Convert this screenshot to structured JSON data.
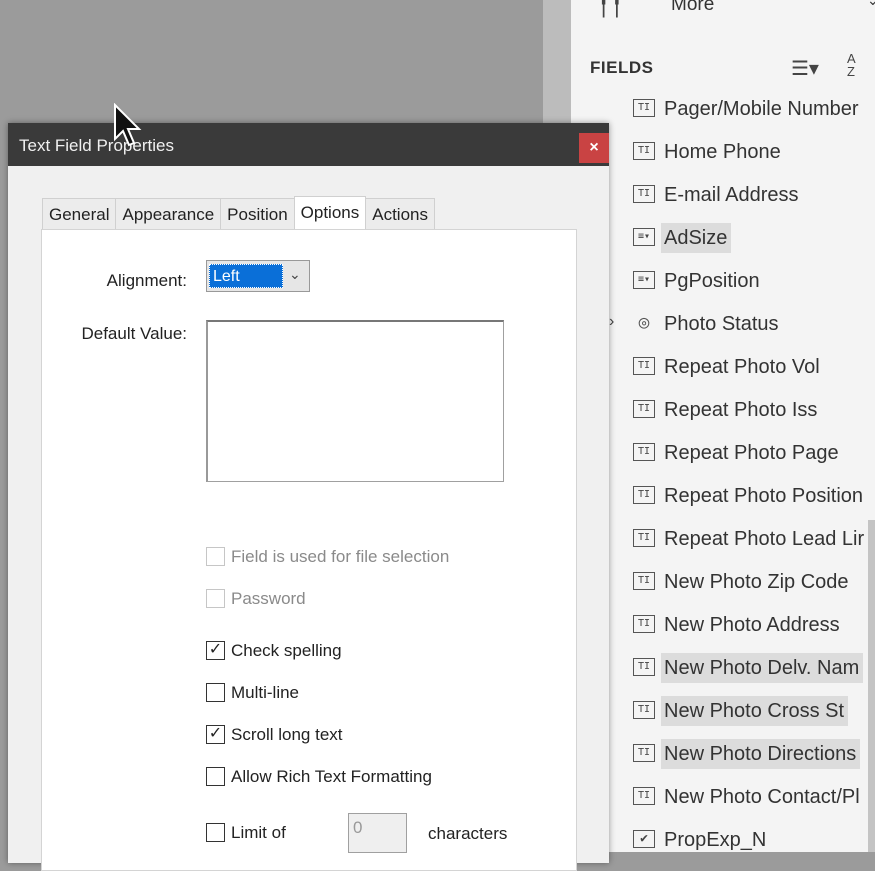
{
  "fields_panel": {
    "more_label": "More",
    "title": "FIELDS",
    "sort_icon": "sort-lines-icon",
    "az_icon": "sort-az-icon",
    "az_top": "A",
    "az_bottom": "Z",
    "items": [
      {
        "name": "Pager/Mobile Number",
        "icon": "TI",
        "kind": "text",
        "hl": false
      },
      {
        "name": "Home Phone",
        "icon": "TI",
        "kind": "text",
        "hl": false
      },
      {
        "name": "E-mail Address",
        "icon": "TI",
        "kind": "text",
        "hl": false
      },
      {
        "name": "AdSize",
        "icon": "≡▾",
        "kind": "combo",
        "hl": true
      },
      {
        "name": "PgPosition",
        "icon": "≡▾",
        "kind": "combo",
        "hl": false
      },
      {
        "name": "Photo Status",
        "icon": "◎",
        "kind": "radio",
        "hl": false,
        "expand": true
      },
      {
        "name": "Repeat Photo Vol",
        "icon": "TI",
        "kind": "text",
        "hl": false
      },
      {
        "name": "Repeat Photo Iss",
        "icon": "TI",
        "kind": "text",
        "hl": false
      },
      {
        "name": "Repeat Photo Page",
        "icon": "TI",
        "kind": "text",
        "hl": false
      },
      {
        "name": "Repeat Photo Position",
        "icon": "TI",
        "kind": "text",
        "hl": false
      },
      {
        "name": "Repeat Photo Lead Lir",
        "icon": "TI",
        "kind": "text",
        "hl": false
      },
      {
        "name": "New Photo Zip Code",
        "icon": "TI",
        "kind": "text",
        "hl": false
      },
      {
        "name": "New Photo Address",
        "icon": "TI",
        "kind": "text",
        "hl": false
      },
      {
        "name": "New Photo Delv. Nam",
        "icon": "TI",
        "kind": "text",
        "hl": true
      },
      {
        "name": "New Photo Cross St",
        "icon": "TI",
        "kind": "text",
        "hl": true
      },
      {
        "name": "New Photo Directions",
        "icon": "TI",
        "kind": "text",
        "hl": true
      },
      {
        "name": "New Photo Contact/Pl",
        "icon": "TI",
        "kind": "text",
        "hl": false
      },
      {
        "name": "PropExp_N",
        "icon": "✔",
        "kind": "check",
        "hl": false
      }
    ]
  },
  "dialog": {
    "title": "Text Field Properties",
    "close": "×",
    "tabs": [
      "General",
      "Appearance",
      "Position",
      "Options",
      "Actions"
    ],
    "active_tab": "Options",
    "alignment_label": "Alignment:",
    "alignment_value": "Left",
    "default_value_label": "Default Value:",
    "default_value": "",
    "file_selection_label": "Field is used for file selection",
    "password_label": "Password",
    "check_spelling_label": "Check spelling",
    "check_spelling_checked": true,
    "multiline_label": "Multi-line",
    "scroll_long_text_label": "Scroll long text",
    "scroll_long_text_checked": true,
    "rich_text_label": "Allow Rich Text Formatting",
    "limit_of_label": "Limit of",
    "limit_value": "0",
    "characters_label": "characters",
    "check_mark": "✓"
  }
}
